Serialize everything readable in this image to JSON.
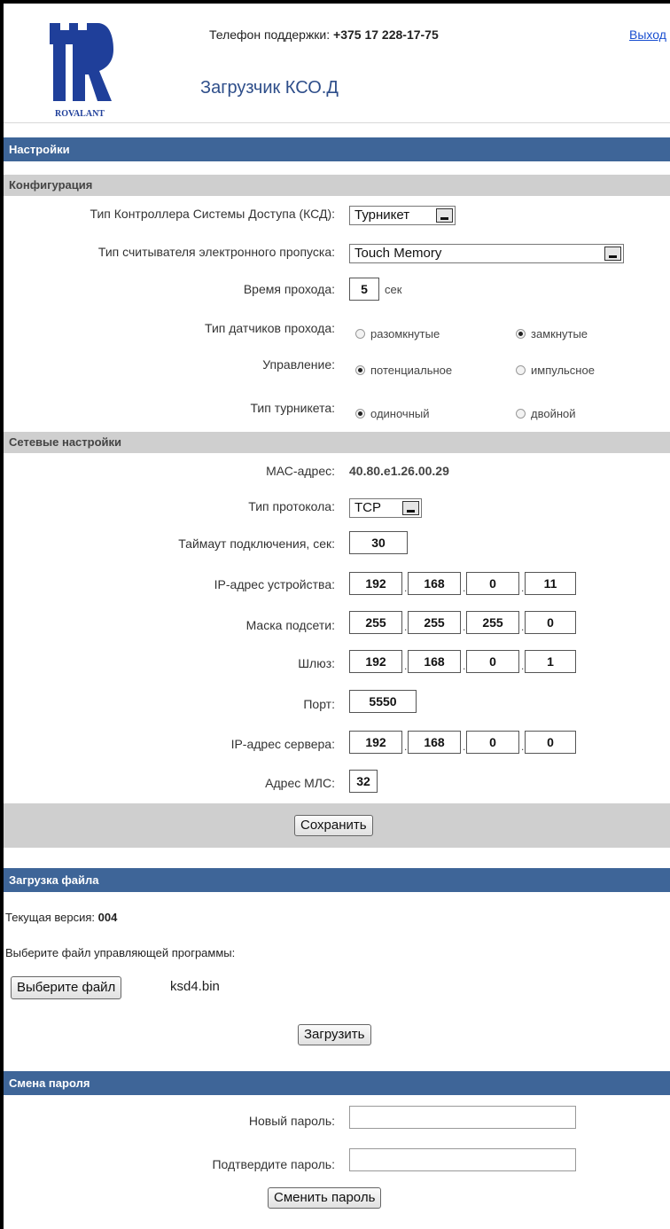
{
  "header": {
    "logo_text": "ROVALANT",
    "support_label": "Телефон поддержки:",
    "support_phone": "+375 17 228-17-75",
    "logout": "Выход",
    "title": "Загрузчик КСО.Д"
  },
  "settings": {
    "section_title": "Настройки",
    "config": {
      "title": "Конфигурация",
      "controller_type_label": "Тип Контроллера Системы Доступа (КСД):",
      "controller_type_value": "Турникет",
      "reader_type_label": "Тип считывателя электронного пропуска:",
      "reader_type_value": "Touch Memory",
      "pass_time_label": "Время прохода:",
      "pass_time_value": "5",
      "pass_time_unit": "сек",
      "sensor_type_label": "Тип датчиков прохода:",
      "sensor_open": "разомкнутые",
      "sensor_closed": "замкнутые",
      "control_label": "Управление:",
      "control_potential": "потенциальное",
      "control_pulse": "импульсное",
      "turnstile_type_label": "Тип турникета:",
      "turnstile_single": "одиночный",
      "turnstile_double": "двойной"
    },
    "network": {
      "title": "Сетевые настройки",
      "mac_label": "МАС-адрес:",
      "mac_value": "40.80.e1.26.00.29",
      "protocol_label": "Тип протокола:",
      "protocol_value": "TCP",
      "timeout_label": "Таймаут подключения, сек:",
      "timeout_value": "30",
      "device_ip_label": "IP-адрес устройства:",
      "device_ip": [
        "192",
        "168",
        "0",
        "11"
      ],
      "mask_label": "Маска подсети:",
      "mask": [
        "255",
        "255",
        "255",
        "0"
      ],
      "gateway_label": "Шлюз:",
      "gateway": [
        "192",
        "168",
        "0",
        "1"
      ],
      "port_label": "Порт:",
      "port_value": "5550",
      "server_ip_label": "IP-адрес сервера:",
      "server_ip": [
        "192",
        "168",
        "0",
        "0"
      ],
      "mls_label": "Адрес МЛС:",
      "mls_value": "32"
    },
    "save_button": "Сохранить"
  },
  "upload": {
    "section_title": "Загрузка файла",
    "current_version_label": "Текущая версия:",
    "current_version_value": "004",
    "choose_prompt": "Выберите файл управляющей программы:",
    "choose_button": "Выберите файл",
    "file_name": "ksd4.bin",
    "upload_button": "Загрузить"
  },
  "password": {
    "section_title": "Смена пароля",
    "new_label": "Новый пароль:",
    "confirm_label": "Подтвердите пароль:",
    "change_button": "Сменить пароль"
  },
  "colors": {
    "section_bar": "#3e6598",
    "subsection_bar": "#cfcfcf",
    "title_text": "#2e4e8a",
    "logo_blue": "#1f3f9a",
    "link": "#1a4fd0"
  }
}
